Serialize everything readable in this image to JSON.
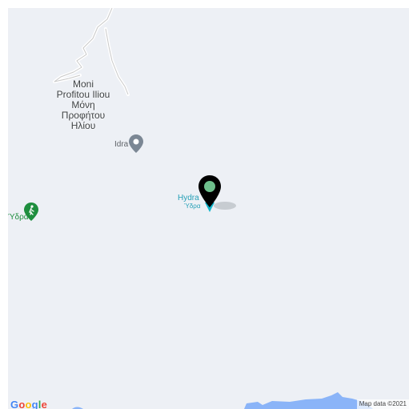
{
  "map": {
    "places": {
      "monastery": {
        "lines": [
          "Moni",
          "Profitou Iliou",
          "Μόνη",
          "Προφήτου",
          "Ηλίου"
        ]
      },
      "idra": {
        "label": "Idra"
      },
      "hydra": {
        "label": "Hydra",
        "label_greek": "Ύδρα"
      },
      "left_place": {
        "label": "Ύδρα"
      }
    },
    "selected_marker_color": "#000000",
    "marker_dot_color": "#6dbf8c",
    "water_color": "#edf0f5",
    "coast_color": "#8ab4f8"
  },
  "attribution": {
    "logo_letters": [
      "G",
      "o",
      "o",
      "g",
      "l",
      "e"
    ],
    "logo_colors": [
      "#4285f4",
      "#ea4335",
      "#fbbc05",
      "#4285f4",
      "#34a853",
      "#ea4335"
    ],
    "map_data": "Map data ©2021"
  }
}
